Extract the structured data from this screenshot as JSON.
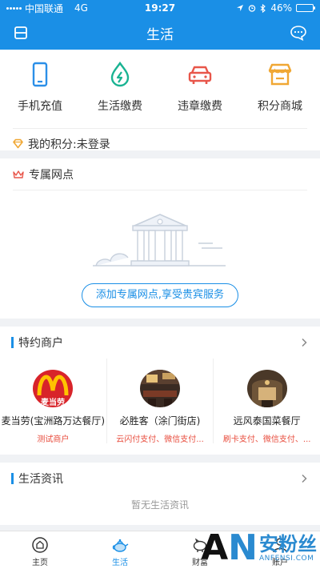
{
  "status_bar": {
    "carrier": "中国联通",
    "network": "4G",
    "time": "19:27",
    "battery": "46%",
    "battery_level": 0.46
  },
  "header": {
    "title": "生活"
  },
  "quick_services": [
    {
      "label": "手机充值",
      "icon": "phone-icon",
      "color": "#2b8fe8"
    },
    {
      "label": "生活缴费",
      "icon": "drop-icon",
      "color": "#19b392"
    },
    {
      "label": "违章缴费",
      "icon": "car-icon",
      "color": "#e8564a"
    },
    {
      "label": "积分商城",
      "icon": "shop-icon",
      "color": "#f0a733"
    }
  ],
  "points": {
    "label": "我的积分:未登录"
  },
  "branch": {
    "title": "专属网点",
    "button_label": "添加专属网点,享受贵宾服务"
  },
  "merchants_section": {
    "title": "特约商户",
    "items": [
      {
        "name": "麦当劳(宝洲路万达餐厅)",
        "pay": "测试商户",
        "logo_text": "麦当劳"
      },
      {
        "name": "必胜客（涂门街店)",
        "pay": "云闪付支付、微信支付..."
      },
      {
        "name": "远风泰国菜餐厅",
        "pay": "刷卡支付、微信支付、..."
      }
    ]
  },
  "info_section": {
    "title": "生活资讯",
    "empty_text": "暂无生活资讯"
  },
  "tabs": [
    {
      "label": "主页",
      "icon": "home-icon"
    },
    {
      "label": "生活",
      "icon": "teapot-icon",
      "active": true
    },
    {
      "label": "财富",
      "icon": "piggy-icon"
    },
    {
      "label": "账户",
      "icon": "user-icon"
    }
  ],
  "watermark": {
    "logo": "AN",
    "text": "安粉丝",
    "domain": "ANFENSI.COM"
  },
  "colors": {
    "primary": "#1a8fe6",
    "accent_red": "#e84c3d"
  }
}
